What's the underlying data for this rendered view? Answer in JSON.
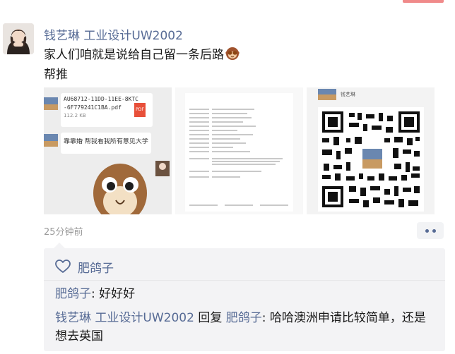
{
  "post": {
    "author": "钱艺琳 工业设计UW2002",
    "text_line1": "家人们咱就是说给自己留一条后路",
    "text_line2": "帮推",
    "time": "25分钟前"
  },
  "images": {
    "thumb1": {
      "code_line1": "AU68712-11DD-11EE-8KTC",
      "code_line2": "-6F779241C1BA.pdf",
      "code_line3": "112.2 KB",
      "file_badge": "PDF",
      "message": "靠靠婚 帮我看我所有意见大学的 offer"
    },
    "thumb3": {
      "header_text": "钱艺琳"
    }
  },
  "likes": {
    "names": [
      "肥鸽子"
    ]
  },
  "comments": [
    {
      "author": "肥鸽子",
      "separator": ": ",
      "text": "好好好"
    },
    {
      "author": "钱艺琳 工业设计UW2002",
      "reply_word": " 回复 ",
      "reply_to": "肥鸽子",
      "separator": ": ",
      "text": "哈哈澳洲申请比较简单，还是想去英国"
    }
  ],
  "colors": {
    "link": "#576b95",
    "comment_bg": "#f3f3f5",
    "accent_bar": "#f08a8a"
  },
  "icons": {
    "like": "heart-outline-icon",
    "more": "more-dots-icon"
  }
}
